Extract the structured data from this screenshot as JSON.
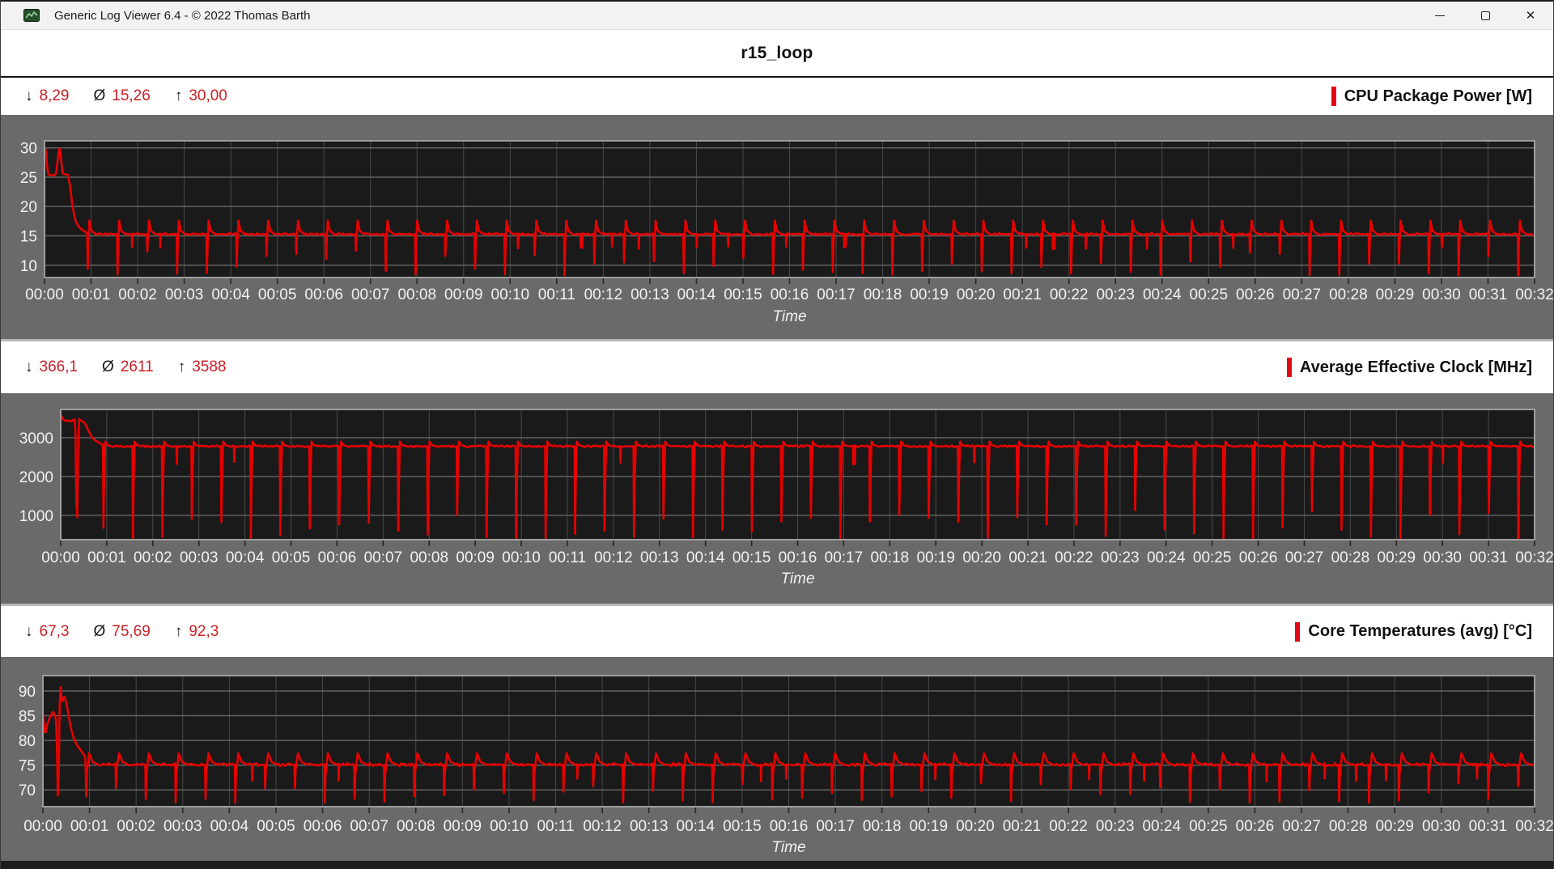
{
  "window": {
    "title": "Generic Log Viewer 6.4 - © 2022 Thomas Barth"
  },
  "header": {
    "title": "r15_loop"
  },
  "axis": {
    "time_label": "Time"
  },
  "sections": [
    {
      "title": "CPU Package Power [W]",
      "accent_color": "#e30613",
      "stats": {
        "min_symbol": "↓",
        "min": "8,29",
        "avg_symbol": "Ø",
        "avg": "15,26",
        "max_symbol": "↑",
        "max": "30,00"
      }
    },
    {
      "title": "Average Effective Clock [MHz]",
      "accent_color": "#e30613",
      "stats": {
        "min_symbol": "↓",
        "min": "366,1",
        "avg_symbol": "Ø",
        "avg": "2611",
        "max_symbol": "↑",
        "max": "3588"
      }
    },
    {
      "title": "Core Temperatures (avg) [°C]",
      "accent_color": "#e30613",
      "stats": {
        "min_symbol": "↓",
        "min": "67,3",
        "avg_symbol": "Ø",
        "avg": "75,69",
        "max_symbol": "↑",
        "max": "92,3"
      }
    }
  ],
  "chart_data": [
    {
      "type": "line",
      "title": "CPU Package Power [W]",
      "ylabel": "CPU Package Power [W]",
      "xlabel": "Time",
      "series_color": "#e60000",
      "stats": {
        "min": 8.29,
        "avg": 15.26,
        "max": 30.0
      },
      "y_ticks": [
        30,
        25,
        20,
        15,
        10
      ],
      "y_domain": [
        7.9,
        31.2
      ],
      "x_ticks": [
        "00:00",
        "00:01",
        "00:02",
        "00:03",
        "00:04",
        "00:05",
        "00:06",
        "00:07",
        "00:08",
        "00:09",
        "00:10",
        "00:11",
        "00:12",
        "00:13",
        "00:14",
        "00:15",
        "00:16",
        "00:17",
        "00:18",
        "00:19",
        "00:20",
        "00:21",
        "00:22",
        "00:23",
        "00:24",
        "00:25",
        "00:26",
        "00:27",
        "00:28",
        "00:29",
        "00:30",
        "00:31",
        "00:32"
      ],
      "x_range_seconds": [
        0,
        1920
      ],
      "legend": "none",
      "grid": true,
      "pattern": {
        "description": "benchmark loop: initial 30W boost plateau then ~38.4s cycles, baseline 15.3W, dip then overshoot each cycle",
        "warmup_points": [
          [
            0,
            30.0
          ],
          [
            2,
            29.7
          ],
          [
            3,
            27.0
          ],
          [
            5,
            25.4
          ],
          [
            13,
            25.3
          ],
          [
            15,
            25.6
          ],
          [
            17,
            28.0
          ],
          [
            19,
            30.0
          ],
          [
            21,
            29.0
          ],
          [
            23,
            25.6
          ],
          [
            30,
            25.4
          ],
          [
            33,
            23.5
          ],
          [
            36,
            20.0
          ],
          [
            40,
            17.5
          ],
          [
            45,
            16.4
          ],
          [
            50,
            15.9
          ],
          [
            55,
            15.5
          ]
        ],
        "cycle": {
          "start_s": 55,
          "period_s": 38.4,
          "baseline": 15.3,
          "peak": 17.6,
          "dip_min": 8.3,
          "dip_max": 12.5,
          "recover_s": 2.8,
          "settle_s": 5.5,
          "flat_s": 11,
          "secondary_dip_prob": 0.35,
          "secondary_dip_level": 13.0,
          "noise": 0.12,
          "seed": 11
        }
      }
    },
    {
      "type": "line",
      "title": "Average Effective Clock [MHz]",
      "ylabel": "Average Effective Clock [MHz]",
      "xlabel": "Time",
      "series_color": "#e60000",
      "stats": {
        "min": 366.1,
        "avg": 2611,
        "max": 3588
      },
      "y_ticks": [
        3000,
        2000,
        1000
      ],
      "y_domain": [
        370,
        3730
      ],
      "x_ticks": [
        "00:00",
        "00:01",
        "00:02",
        "00:03",
        "00:04",
        "00:05",
        "00:06",
        "00:07",
        "00:08",
        "00:09",
        "00:10",
        "00:11",
        "00:12",
        "00:13",
        "00:14",
        "00:15",
        "00:16",
        "00:17",
        "00:18",
        "00:19",
        "00:20",
        "00:21",
        "00:22",
        "00:23",
        "00:24",
        "00:25",
        "00:26",
        "00:27",
        "00:28",
        "00:29",
        "00:30",
        "00:31",
        "00:32"
      ],
      "x_range_seconds": [
        0,
        1920
      ],
      "legend": "none",
      "grid": true,
      "pattern": {
        "description": "starts ~3550 MHz, decays to ~2780 MHz baseline with deep dips (~400-1150 MHz) every ~38.4s",
        "warmup_points": [
          [
            0,
            3580
          ],
          [
            2,
            3520
          ],
          [
            4,
            3450
          ],
          [
            7,
            3430
          ],
          [
            10,
            3450
          ],
          [
            13,
            3420
          ],
          [
            16,
            3450
          ],
          [
            19,
            3490
          ],
          [
            20.5,
            1200
          ],
          [
            21.3,
            420
          ],
          [
            22.5,
            2500
          ],
          [
            24,
            3480
          ],
          [
            27,
            3440
          ],
          [
            30,
            3400
          ],
          [
            33,
            3320
          ],
          [
            37,
            3150
          ],
          [
            41,
            3000
          ],
          [
            45,
            2930
          ],
          [
            50,
            2870
          ],
          [
            55,
            2820
          ]
        ],
        "cycle": {
          "start_s": 55,
          "period_s": 38.4,
          "baseline": 2780,
          "peak": 2900,
          "dip_min": 380,
          "dip_max": 1150,
          "recover_s": 3.0,
          "settle_s": 6.0,
          "flat_s": 11,
          "secondary_dip_prob": 0.15,
          "secondary_dip_level": 2350,
          "noise": 18,
          "seed": 22
        }
      }
    },
    {
      "type": "line",
      "title": "Core Temperatures (avg) [°C]",
      "ylabel": "Core Temperatures (avg) [°C]",
      "xlabel": "Time",
      "series_color": "#e60000",
      "stats": {
        "min": 67.3,
        "avg": 75.69,
        "max": 92.3
      },
      "y_ticks": [
        90,
        85,
        80,
        75,
        70
      ],
      "y_domain": [
        66.6,
        93.1
      ],
      "x_ticks": [
        "00:00",
        "00:01",
        "00:02",
        "00:03",
        "00:04",
        "00:05",
        "00:06",
        "00:07",
        "00:08",
        "00:09",
        "00:10",
        "00:11",
        "00:12",
        "00:13",
        "00:14",
        "00:15",
        "00:16",
        "00:17",
        "00:18",
        "00:19",
        "00:20",
        "00:21",
        "00:22",
        "00:23",
        "00:24",
        "00:25",
        "00:26",
        "00:27",
        "00:28",
        "00:29",
        "00:30",
        "00:31",
        "00:32"
      ],
      "x_range_seconds": [
        0,
        1920
      ],
      "legend": "none",
      "grid": true,
      "pattern": {
        "description": "spike to 92.3°C during warmup, settles to ~75°C baseline with dips to ~67-71°C every ~38.4s",
        "warmup_points": [
          [
            0,
            85.3
          ],
          [
            2,
            82.0
          ],
          [
            3,
            81.2
          ],
          [
            6,
            83.5
          ],
          [
            10,
            85.0
          ],
          [
            13,
            85.8
          ],
          [
            15,
            85.2
          ],
          [
            17.5,
            84.0
          ],
          [
            19,
            68.2
          ],
          [
            20.5,
            73.0
          ],
          [
            22,
            92.3
          ],
          [
            24,
            88.5
          ],
          [
            25.5,
            87.8
          ],
          [
            27,
            89.0
          ],
          [
            29,
            88.3
          ],
          [
            31,
            87.0
          ],
          [
            33,
            85.0
          ],
          [
            36,
            82.5
          ],
          [
            40,
            80.3
          ],
          [
            44,
            79.0
          ],
          [
            48,
            78.2
          ],
          [
            52,
            77.3
          ],
          [
            55,
            76.6
          ]
        ],
        "cycle": {
          "start_s": 55,
          "period_s": 38.4,
          "baseline": 75.1,
          "peak": 77.4,
          "dip_min": 67.4,
          "dip_max": 71.5,
          "recover_s": 4.5,
          "settle_s": 9.0,
          "flat_s": 16,
          "secondary_dip_prob": 0.3,
          "secondary_dip_level": 72.0,
          "noise": 0.2,
          "seed": 33
        }
      }
    }
  ]
}
